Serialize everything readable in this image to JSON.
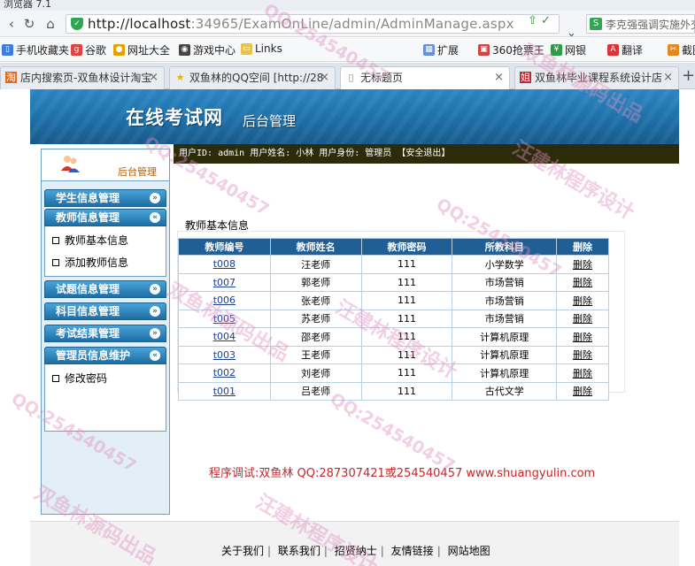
{
  "browser": {
    "title_fragment": "浏览器 7.1",
    "url_host": "http://localhost",
    "url_rest": ":34965/ExamOnLine/admin/AdminManage.aspx",
    "search_text": "李克强强调实施外交",
    "bookmarks": [
      "手机收藏夹",
      "谷歌",
      "网址大全",
      "游戏中心",
      "Links",
      "扩展",
      "360抢票王",
      "网银",
      "翻译",
      "截图"
    ],
    "tabs": [
      {
        "label": "店内搜索页-双鱼林设计淘宝"
      },
      {
        "label": "双鱼林的QQ空间 [http://28"
      },
      {
        "label": "无标题页"
      },
      {
        "label": "双鱼林毕业课程系统设计店"
      }
    ]
  },
  "header": {
    "title": "在线考试网",
    "subtitle": "后台管理",
    "user_info": "用户ID: admin  用户姓名: 小林  用户身份: 管理员 【安全退出】"
  },
  "sidebar": {
    "label": "后台管理",
    "menus": [
      {
        "label": "学生信息管理"
      },
      {
        "label": "教师信息管理",
        "items": [
          "教师基本信息",
          "添加教师信息"
        ]
      },
      {
        "label": "试题信息管理"
      },
      {
        "label": "科目信息管理"
      },
      {
        "label": "考试结果管理"
      },
      {
        "label": "管理员信息维护",
        "items": [
          "修改密码"
        ]
      }
    ]
  },
  "main": {
    "section_title": "教师基本信息",
    "columns": [
      "教师编号",
      "教师姓名",
      "教师密码",
      "所教科目",
      "删除"
    ],
    "rows": [
      {
        "id": "t008",
        "name": "汪老师",
        "password": "111",
        "subject": "小学数学",
        "action": "删除"
      },
      {
        "id": "t007",
        "name": "郭老师",
        "password": "111",
        "subject": "市场营销",
        "action": "删除"
      },
      {
        "id": "t006",
        "name": "张老师",
        "password": "111",
        "subject": "市场营销",
        "action": "删除"
      },
      {
        "id": "t005",
        "name": "苏老师",
        "password": "111",
        "subject": "市场营销",
        "action": "删除"
      },
      {
        "id": "t004",
        "name": "邵老师",
        "password": "111",
        "subject": "计算机原理",
        "action": "删除"
      },
      {
        "id": "t003",
        "name": "王老师",
        "password": "111",
        "subject": "计算机原理",
        "action": "删除"
      },
      {
        "id": "t002",
        "name": "刘老师",
        "password": "111",
        "subject": "计算机原理",
        "action": "删除"
      },
      {
        "id": "t001",
        "name": "吕老师",
        "password": "111",
        "subject": "古代文学",
        "action": "删除"
      }
    ],
    "credit": "程序调试:双鱼林 QQ:287307421或254540457 www.shuangyulin.com"
  },
  "footer": {
    "links": [
      "关于我们",
      "联系我们",
      "招贤纳士",
      "友情链接",
      "网站地图"
    ]
  },
  "watermarks": [
    "QQ:254540457",
    "双鱼林源码出品",
    "汪建林程序设计"
  ]
}
